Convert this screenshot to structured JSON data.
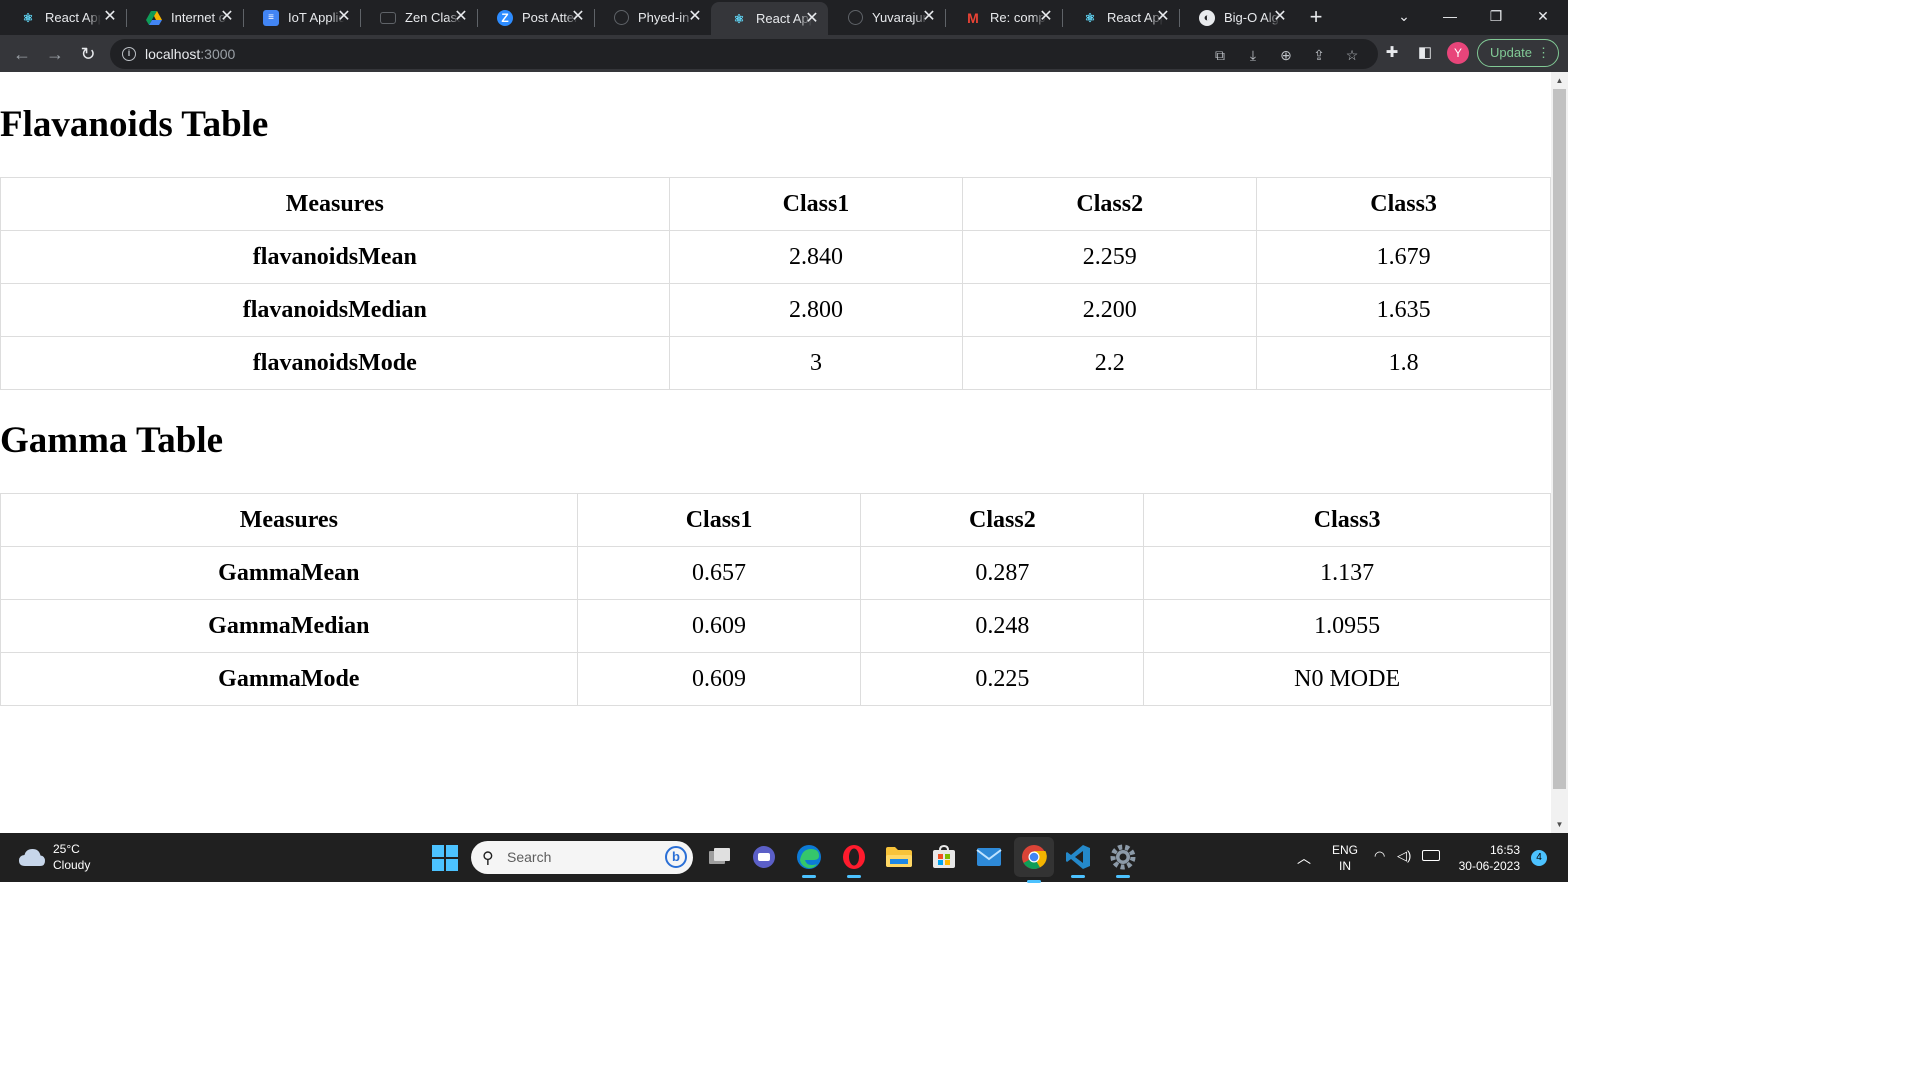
{
  "browser": {
    "tabs": [
      {
        "label": "React App",
        "icon": "react-icon",
        "active": false
      },
      {
        "label": "Internet of Things",
        "icon": "google-drive-icon",
        "active": false
      },
      {
        "label": "IoT Application",
        "icon": "google-docs-icon",
        "active": false
      },
      {
        "label": "Zen Class",
        "icon": "zen-class-icon",
        "active": false
      },
      {
        "label": "Post Attendance",
        "icon": "zoom-icon",
        "active": false
      },
      {
        "label": "Phyed-in",
        "icon": "github-icon",
        "active": false
      },
      {
        "label": "React App",
        "icon": "react-icon",
        "active": true
      },
      {
        "label": "Yuvarajur",
        "icon": "github-icon",
        "active": false
      },
      {
        "label": "Re: comp",
        "icon": "gmail-icon",
        "active": false
      },
      {
        "label": "React App",
        "icon": "react-icon",
        "active": false
      },
      {
        "label": "Big-O Algorithm",
        "icon": "globe-icon",
        "active": false
      }
    ],
    "close_glyph": "✕",
    "new_tab_glyph": "+",
    "address": {
      "host": "localhost",
      "port": ":3000"
    },
    "profile_initial": "Y",
    "update_label": "Update",
    "colors": {
      "tab_strip": "#202124",
      "toolbar": "#35363a",
      "update_accent": "#81c995",
      "avatar": "#e8457a"
    }
  },
  "page": {
    "flavanoids": {
      "title": "Flavanoids Table",
      "headers": [
        "Measures",
        "Class1",
        "Class2",
        "Class3"
      ],
      "rows": [
        [
          "flavanoidsMean",
          "2.840",
          "2.259",
          "1.679"
        ],
        [
          "flavanoidsMedian",
          "2.800",
          "2.200",
          "1.635"
        ],
        [
          "flavanoidsMode",
          "3",
          "2.2",
          "1.8"
        ]
      ]
    },
    "gamma": {
      "title": "Gamma Table",
      "headers": [
        "Measures",
        "Class1",
        "Class2",
        "Class3"
      ],
      "rows": [
        [
          "GammaMean",
          "0.657",
          "0.287",
          "1.137"
        ],
        [
          "GammaMedian",
          "0.609",
          "0.248",
          "1.0955"
        ],
        [
          "GammaMode",
          "0.609",
          "0.225",
          "N0 MODE"
        ]
      ]
    },
    "colors": {
      "cell_border": "#dddddd"
    }
  },
  "taskbar": {
    "weather": {
      "temp": "25°C",
      "condition": "Cloudy"
    },
    "search_label": "Search",
    "apps": [
      "task-view-icon",
      "teams-chat-icon",
      "edge-icon",
      "opera-icon",
      "file-explorer-icon",
      "microsoft-store-icon",
      "mail-icon",
      "chrome-icon",
      "vscode-icon",
      "settings-icon"
    ],
    "language": {
      "lang": "ENG",
      "region": "IN"
    },
    "clock": {
      "time": "16:53",
      "date": "30-06-2023"
    },
    "notification_count": "4",
    "colors": {
      "background": "#202020",
      "accent": "#4cc2ff"
    }
  }
}
